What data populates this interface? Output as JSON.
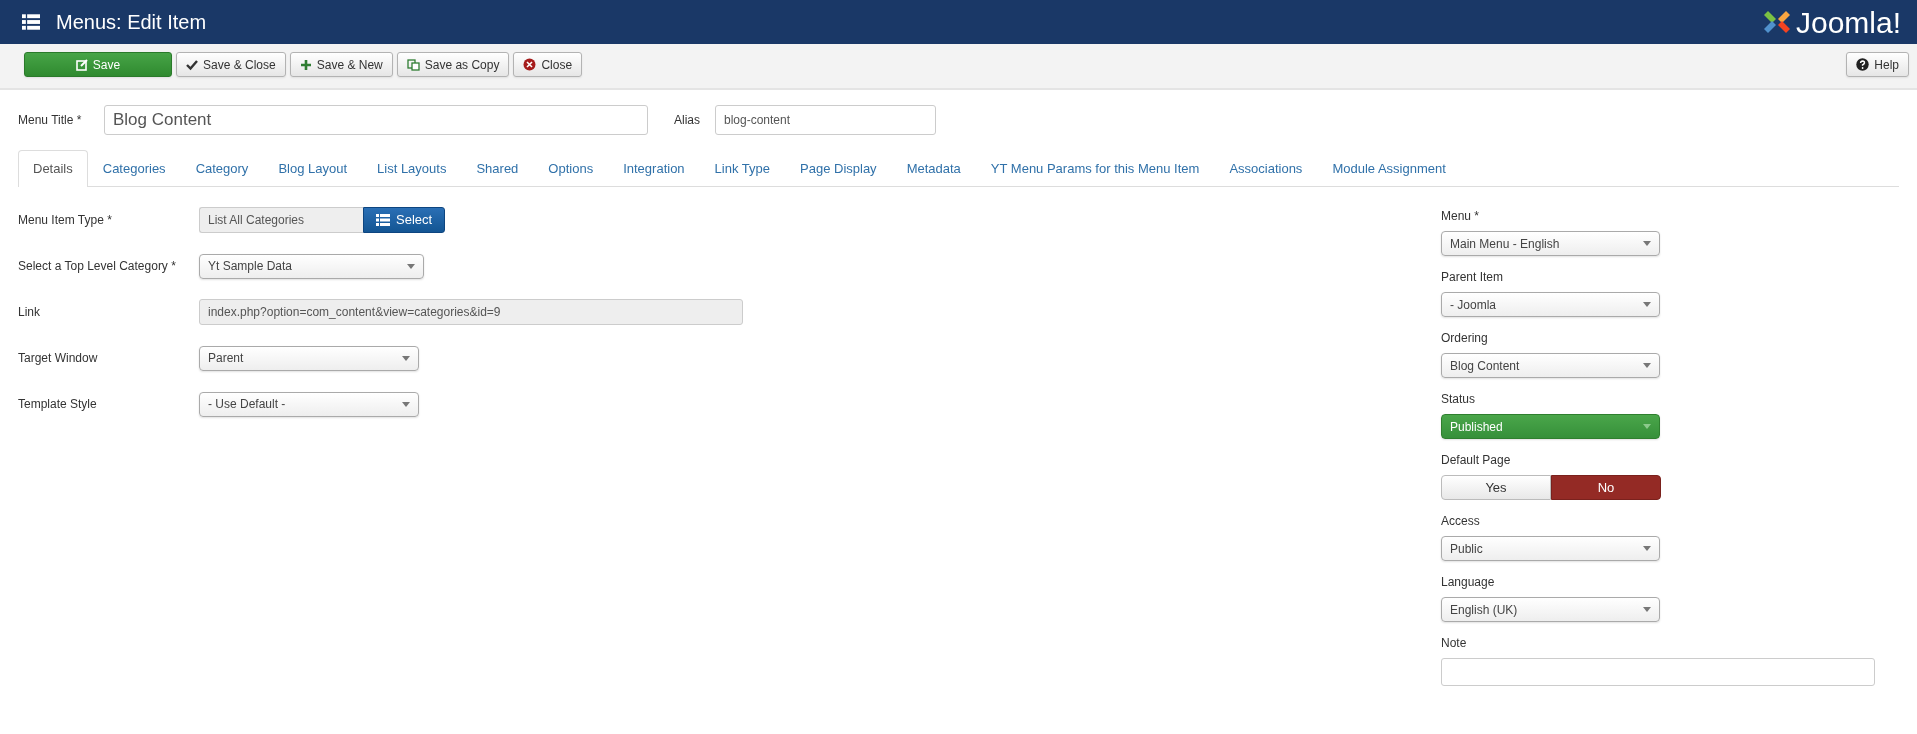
{
  "header": {
    "title": "Menus: Edit Item",
    "logo_text": "Joomla!"
  },
  "toolbar": {
    "buttons": [
      {
        "label": "Save",
        "kind": "edit"
      },
      {
        "label": "Save & Close",
        "kind": "check"
      },
      {
        "label": "Save & New",
        "kind": "plus"
      },
      {
        "label": "Save as Copy",
        "kind": "copy"
      },
      {
        "label": "Close",
        "kind": "close"
      }
    ],
    "help": {
      "label": "Help",
      "kind": "help"
    }
  },
  "title_row": {
    "title_label": "Menu Title *",
    "title_value": "Blog Content",
    "alias_label": "Alias",
    "alias_value": "blog-content"
  },
  "tabs": [
    {
      "label": "Details",
      "selected": true
    },
    {
      "label": "Categories",
      "selected": false
    },
    {
      "label": "Category",
      "selected": false
    },
    {
      "label": "Blog Layout",
      "selected": false
    },
    {
      "label": "List Layouts",
      "selected": false
    },
    {
      "label": "Shared",
      "selected": false
    },
    {
      "label": "Options",
      "selected": false
    },
    {
      "label": "Integration",
      "selected": false
    },
    {
      "label": "Link Type",
      "selected": false
    },
    {
      "label": "Page Display",
      "selected": false
    },
    {
      "label": "Metadata",
      "selected": false
    },
    {
      "label": "YT Menu Params for this Menu Item",
      "selected": false
    },
    {
      "label": "Associations",
      "selected": false
    },
    {
      "label": "Module Assignment",
      "selected": false
    }
  ],
  "left_fields": [
    {
      "kind": "typepicker",
      "label": "Menu Item Type *",
      "value": "List All Categories",
      "button": "Select"
    },
    {
      "kind": "select",
      "label": "Select a Top Level Category *",
      "value": "Yt Sample Data"
    },
    {
      "kind": "readonly",
      "label": "Link",
      "value": "index.php?option=com_content&view=categories&id=9"
    },
    {
      "kind": "select",
      "label": "Target Window",
      "value": "Parent"
    },
    {
      "kind": "select",
      "label": "Template Style",
      "value": "- Use Default -"
    }
  ],
  "right_fields": [
    {
      "kind": "select",
      "label": "Menu *",
      "value": "Main Menu - English"
    },
    {
      "kind": "select",
      "label": "Parent Item",
      "value": "- Joomla"
    },
    {
      "kind": "select",
      "label": "Ordering",
      "value": "Blog Content"
    },
    {
      "kind": "status",
      "label": "Status",
      "value": "Published"
    },
    {
      "kind": "toggle",
      "label": "Default Page",
      "options": [
        {
          "label": "Yes",
          "selected": false
        },
        {
          "label": "No",
          "selected": true
        }
      ]
    },
    {
      "kind": "select",
      "label": "Access",
      "value": "Public"
    },
    {
      "kind": "select",
      "label": "Language",
      "value": "English (UK)"
    },
    {
      "kind": "text",
      "label": "Note"
    }
  ]
}
